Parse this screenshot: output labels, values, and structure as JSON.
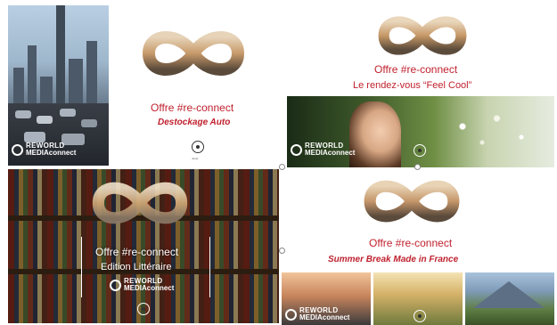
{
  "panels": [
    {
      "offer_title": "Offre #re-connect",
      "subtitle": "Destockage Auto",
      "logo_line1": "REWORLD",
      "logo_line2a": "MEDIA",
      "logo_line2b": "connect",
      "play_label": "Jouer"
    },
    {
      "offer_title": "Offre #re-connect",
      "subtitle": "Le rendez-vous “Feel Cool”",
      "logo_line1": "REWORLD",
      "logo_line2a": "MEDIA",
      "logo_line2b": "connect"
    },
    {
      "offer_title": "Offre #re-connect",
      "subtitle": "Edition Littéraire",
      "logo_line1": "REWORLD",
      "logo_line2a": "MEDIA",
      "logo_line2b": "connect"
    },
    {
      "offer_title": "Offre #re-connect",
      "subtitle": "Summer Break Made in France",
      "logo_line1": "REWORLD",
      "logo_line2a": "MEDIA",
      "logo_line2b": "connect"
    }
  ],
  "colors": {
    "brand_red": "#c0212e",
    "white": "#ffffff"
  },
  "icons": [
    "infinity-logo-icon",
    "play-icon",
    "reworld-logo-icon"
  ]
}
